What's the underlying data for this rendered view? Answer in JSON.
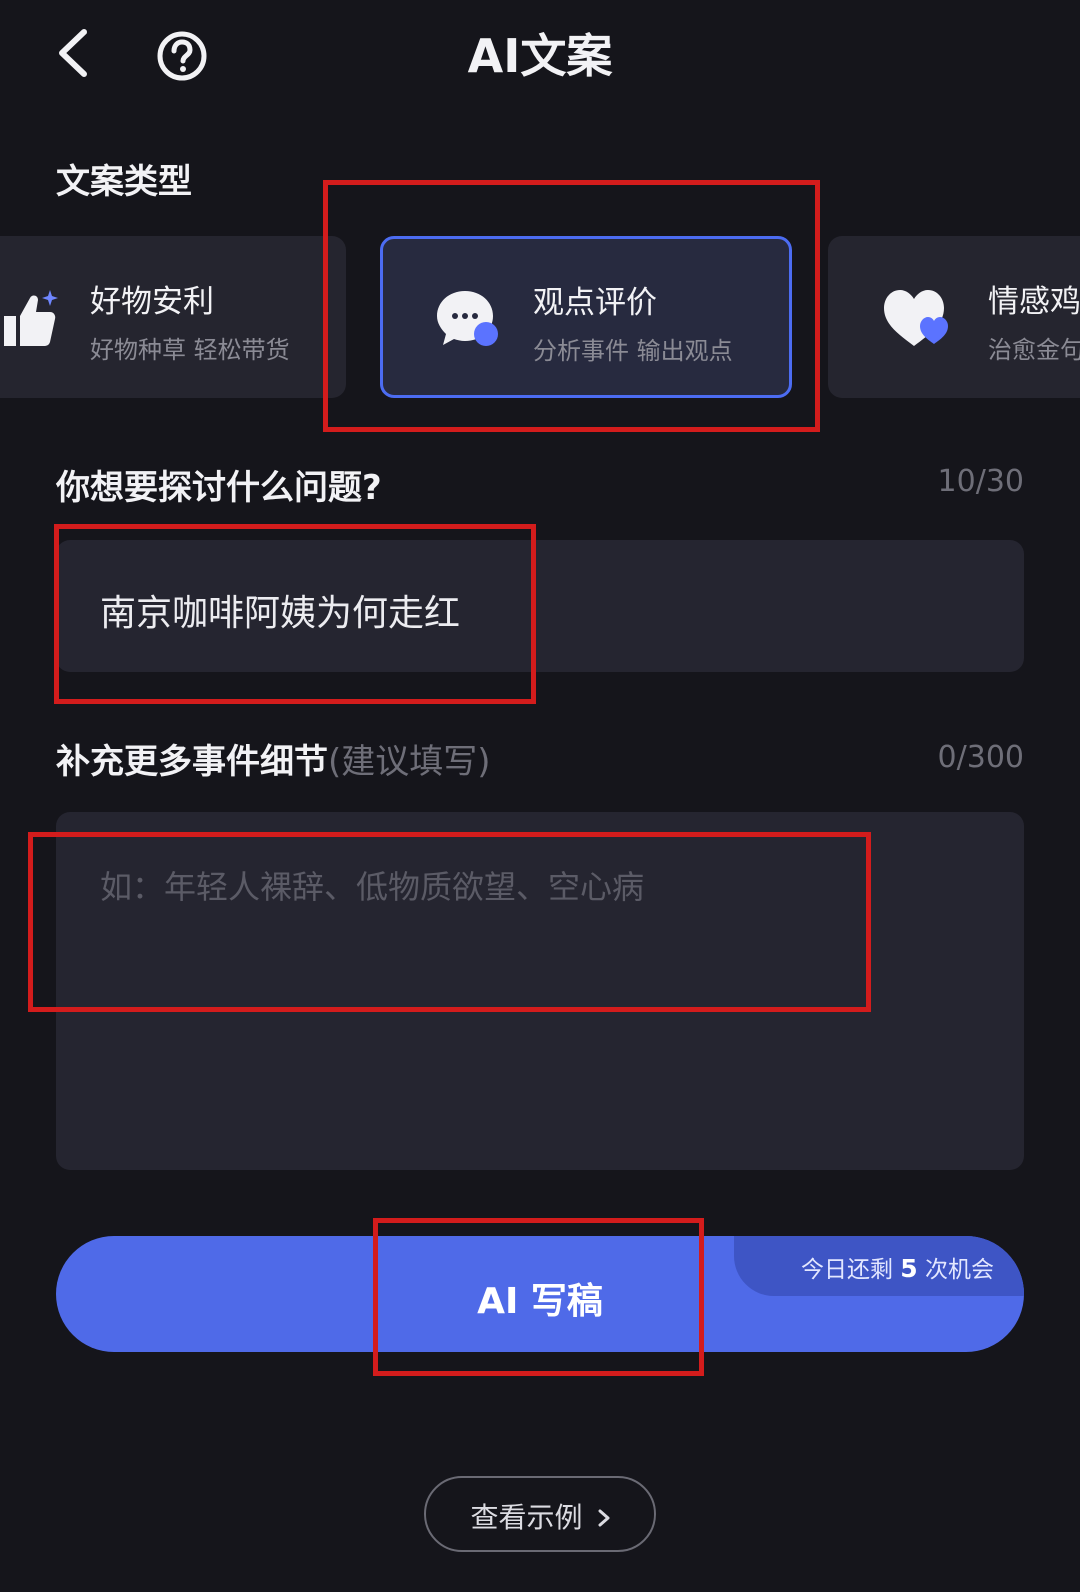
{
  "header": {
    "title": "AI文案"
  },
  "type_section": {
    "title": "文案类型",
    "cards": [
      {
        "title": "好物安利",
        "subtitle": "好物种草 轻松带货"
      },
      {
        "title": "观点评价",
        "subtitle": "分析事件 输出观点",
        "selected": true
      },
      {
        "title": "情感鸡",
        "subtitle": "治愈金句"
      }
    ]
  },
  "question": {
    "label": "你想要探讨什么问题?",
    "counter": "10/30",
    "value": "南京咖啡阿姨为何走红"
  },
  "details": {
    "label": "补充更多事件细节",
    "hint": "(建议填写)",
    "counter": "0/300",
    "placeholder": "如：年轻人裸辞、低物质欲望、空心病"
  },
  "cta": {
    "label": "AI 写稿",
    "quota_prefix": "今日还剩",
    "quota_count": "5",
    "quota_suffix": "次机会"
  },
  "example": {
    "label": "查看示例"
  },
  "colors": {
    "accent": "#4f6ae8",
    "background": "#15151b",
    "annotation": "#d31c1c"
  }
}
